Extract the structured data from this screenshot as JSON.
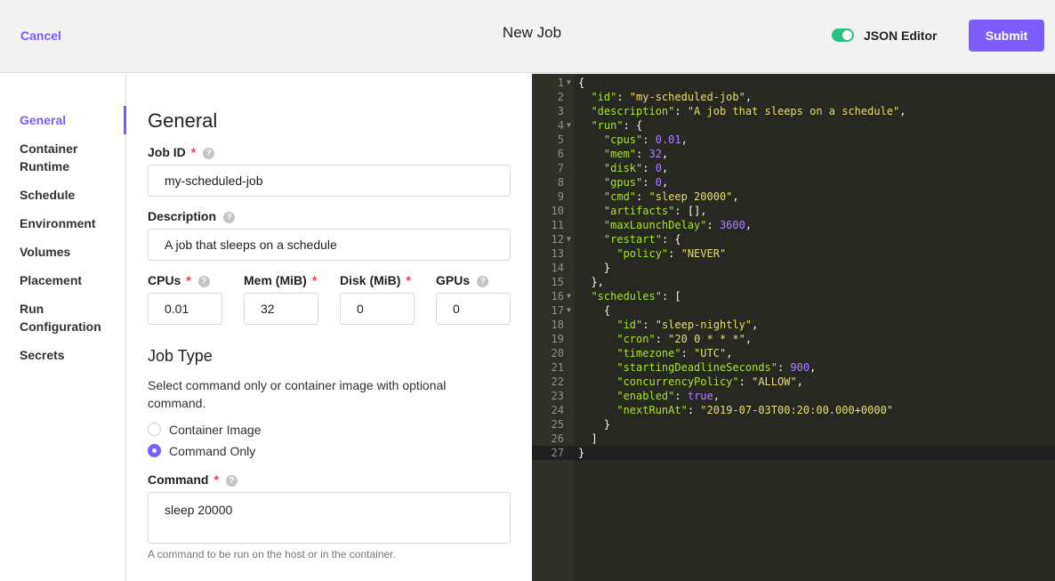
{
  "header": {
    "cancel": "Cancel",
    "title": "New Job",
    "json_editor_label": "JSON Editor",
    "json_editor_on": true,
    "submit": "Submit"
  },
  "sidebar": {
    "items": [
      "General",
      "Container Runtime",
      "Schedule",
      "Environment",
      "Volumes",
      "Placement",
      "Run Configuration",
      "Secrets"
    ],
    "active": "General"
  },
  "form": {
    "heading": "General",
    "job_id": {
      "label": "Job ID",
      "value": "my-scheduled-job"
    },
    "description": {
      "label": "Description",
      "value": "A job that sleeps on a schedule"
    },
    "cpus": {
      "label": "CPUs",
      "value": "0.01"
    },
    "mem": {
      "label": "Mem (MiB)",
      "value": "32"
    },
    "disk": {
      "label": "Disk (MiB)",
      "value": "0"
    },
    "gpus": {
      "label": "GPUs",
      "value": "0"
    },
    "job_type": {
      "heading": "Job Type",
      "hint": "Select command only or container image with optional command.",
      "options": [
        "Container Image",
        "Command Only"
      ],
      "selected": "Command Only"
    },
    "command": {
      "label": "Command",
      "value": "sleep 20000",
      "help": "A command to be run on the host or in the container."
    },
    "required_mark": "*",
    "help_icon": "?"
  },
  "editor": {
    "lines": [
      "{",
      "  \"id\": \"my-scheduled-job\",",
      "  \"description\": \"A job that sleeps on a schedule\",",
      "  \"run\": {",
      "    \"cpus\": 0.01,",
      "    \"mem\": 32,",
      "    \"disk\": 0,",
      "    \"gpus\": 0,",
      "    \"cmd\": \"sleep 20000\",",
      "    \"artifacts\": [],",
      "    \"maxLaunchDelay\": 3600,",
      "    \"restart\": {",
      "      \"policy\": \"NEVER\"",
      "    }",
      "  },",
      "  \"schedules\": [",
      "    {",
      "      \"id\": \"sleep-nightly\",",
      "      \"cron\": \"20 0 * * *\",",
      "      \"timezone\": \"UTC\",",
      "      \"startingDeadlineSeconds\": 900,",
      "      \"concurrencyPolicy\": \"ALLOW\",",
      "      \"enabled\": true,",
      "      \"nextRunAt\": \"2019-07-03T00:20:00.000+0000\"",
      "    }",
      "  ]",
      "}"
    ],
    "fold_lines": [
      1,
      4,
      12,
      16,
      17
    ],
    "current_line": 27,
    "colors": {
      "key": "#a6e22e",
      "string": "#e6db74",
      "number": "#ae81ff"
    }
  }
}
